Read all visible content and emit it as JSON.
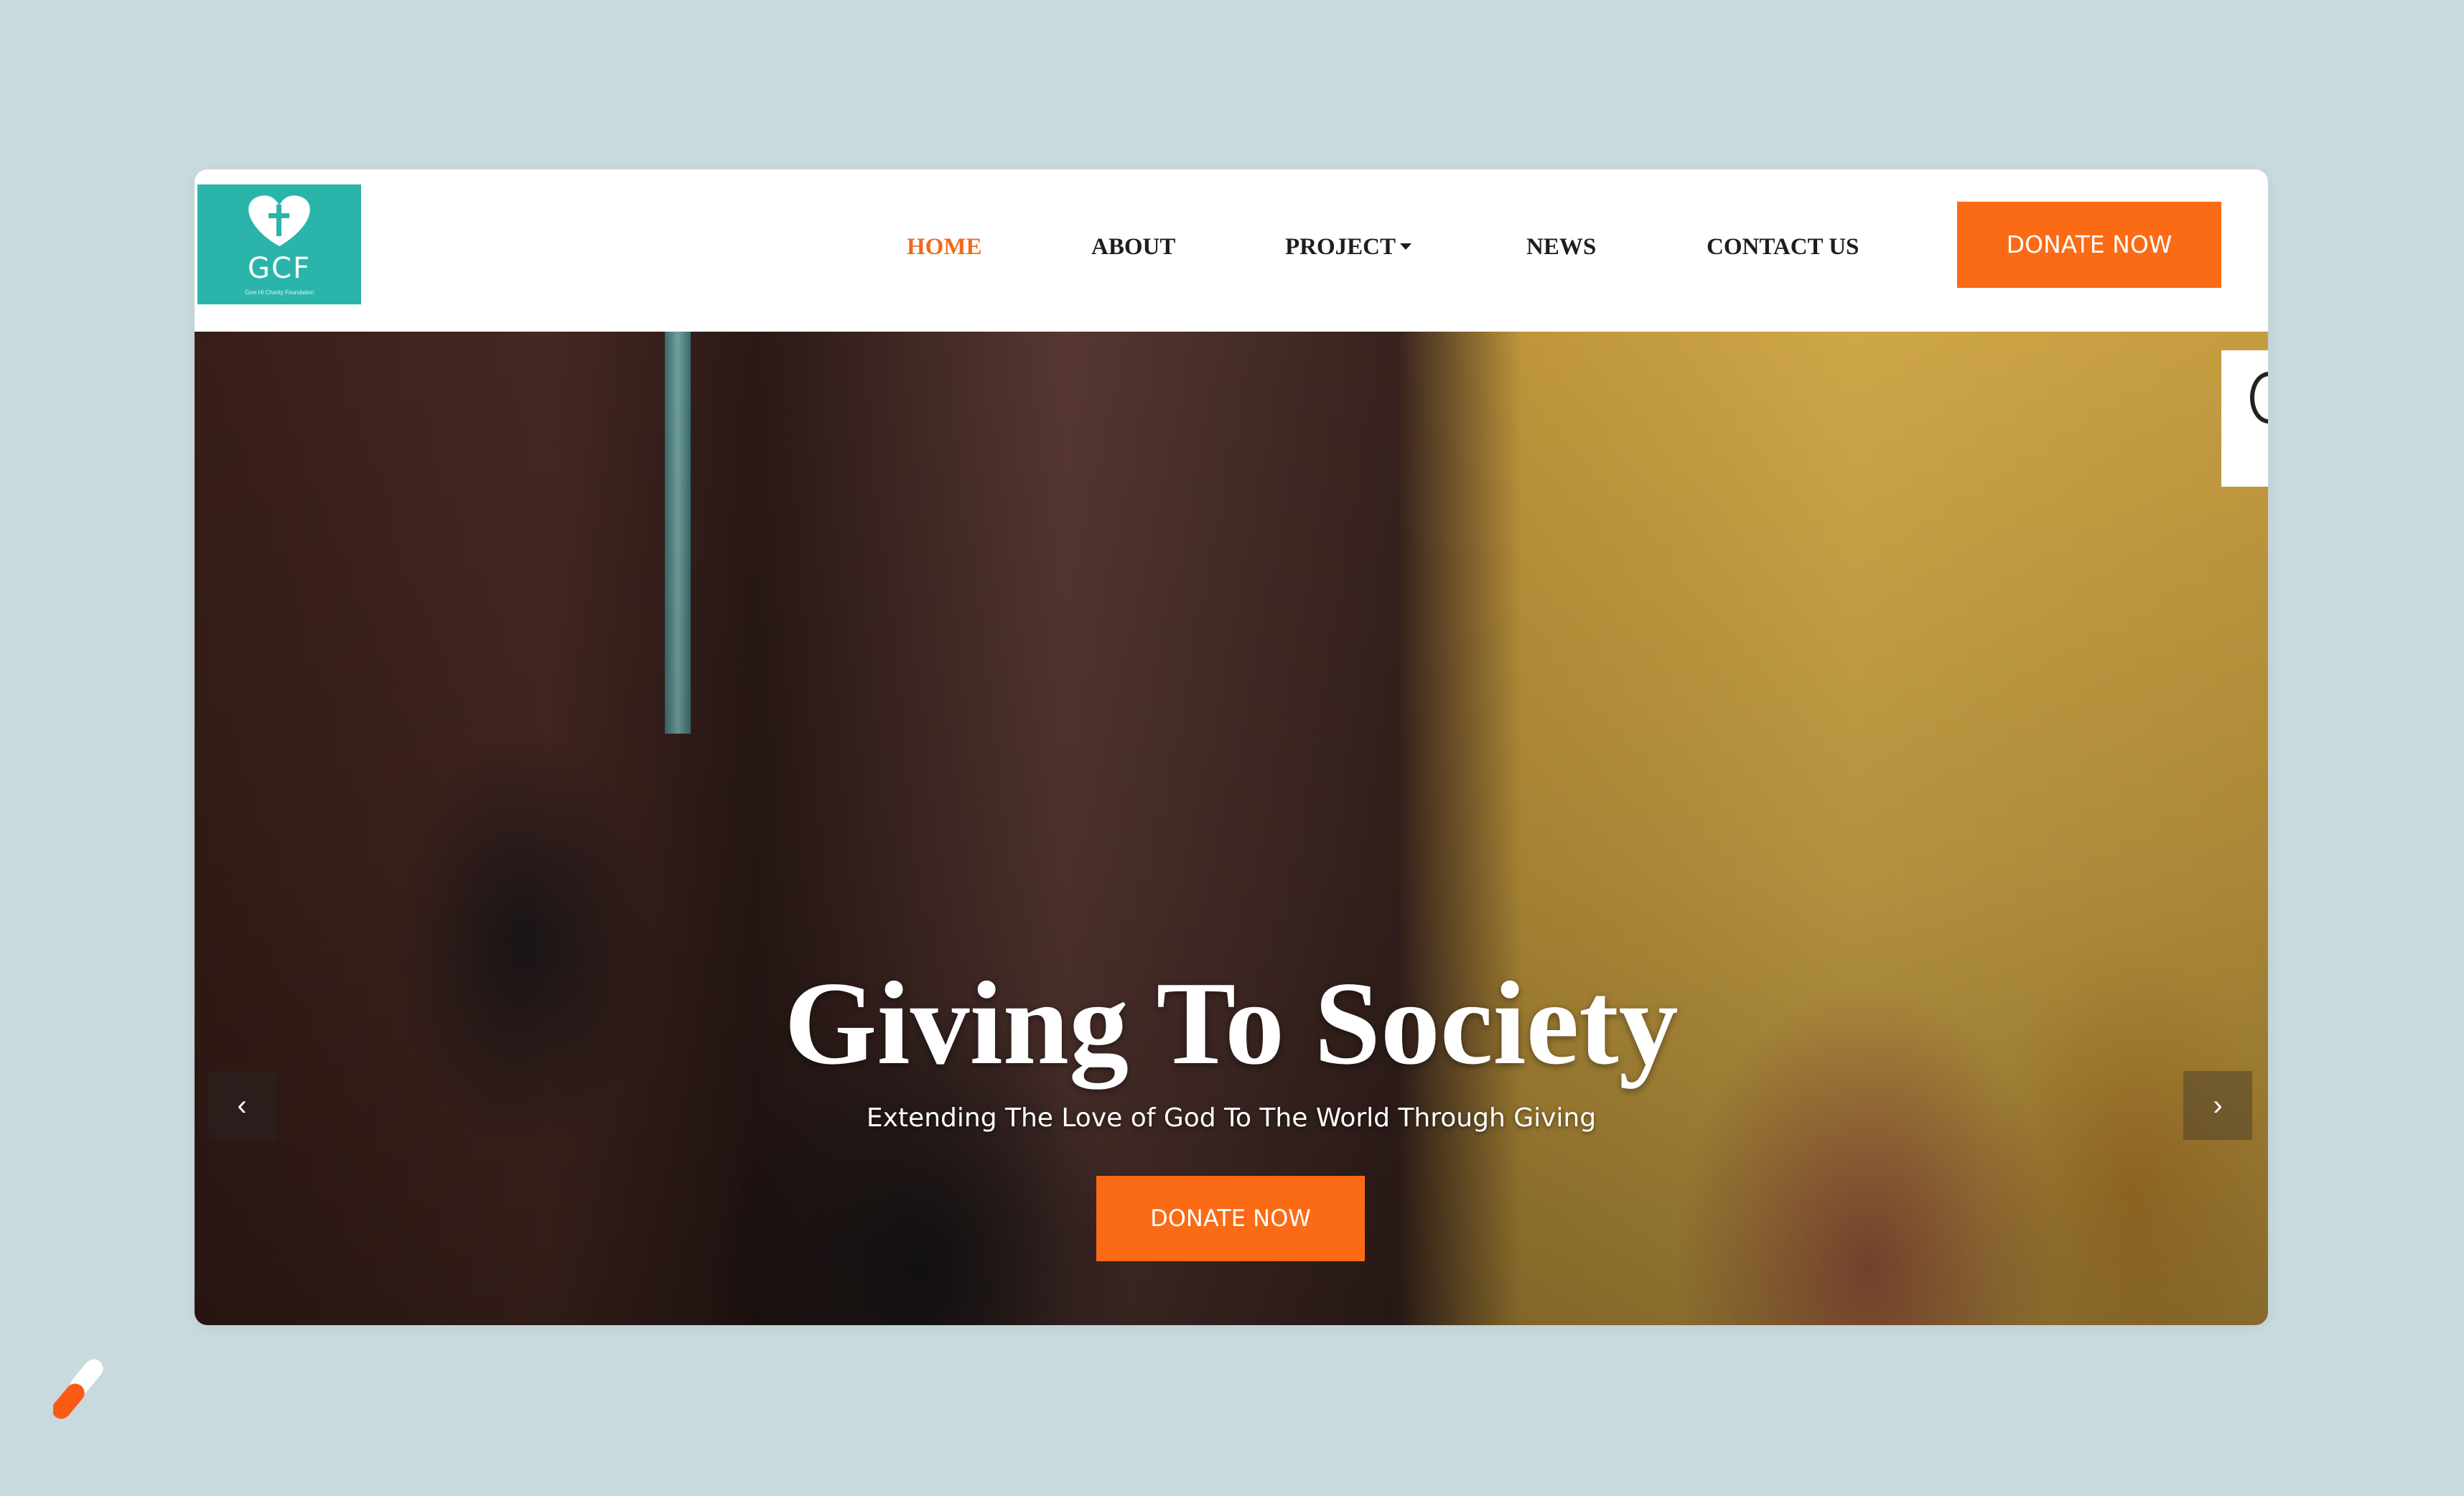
{
  "header": {
    "logo": {
      "text": "GCF",
      "tagline": "Give Hi Charity Foundation",
      "icon": "heart-cross-icon"
    },
    "nav": [
      {
        "label": "HOME",
        "active": true
      },
      {
        "label": "ABOUT",
        "active": false
      },
      {
        "label": "PROJECT",
        "active": false,
        "dropdown": true
      },
      {
        "label": "NEWS",
        "active": false
      },
      {
        "label": "CONTACT US",
        "active": false
      }
    ],
    "donate_label": "DONATE NOW"
  },
  "hero": {
    "title": "Giving To Society",
    "subtitle": "Extending The Love of God To The World Through Giving",
    "donate_label": "DONATE NOW",
    "prev_icon": "chevron-left-icon",
    "next_icon": "chevron-right-icon"
  },
  "colors": {
    "accent": "#fb6a14",
    "logo_bg": "#2bb5aa",
    "page_bg": "#c9dade"
  }
}
